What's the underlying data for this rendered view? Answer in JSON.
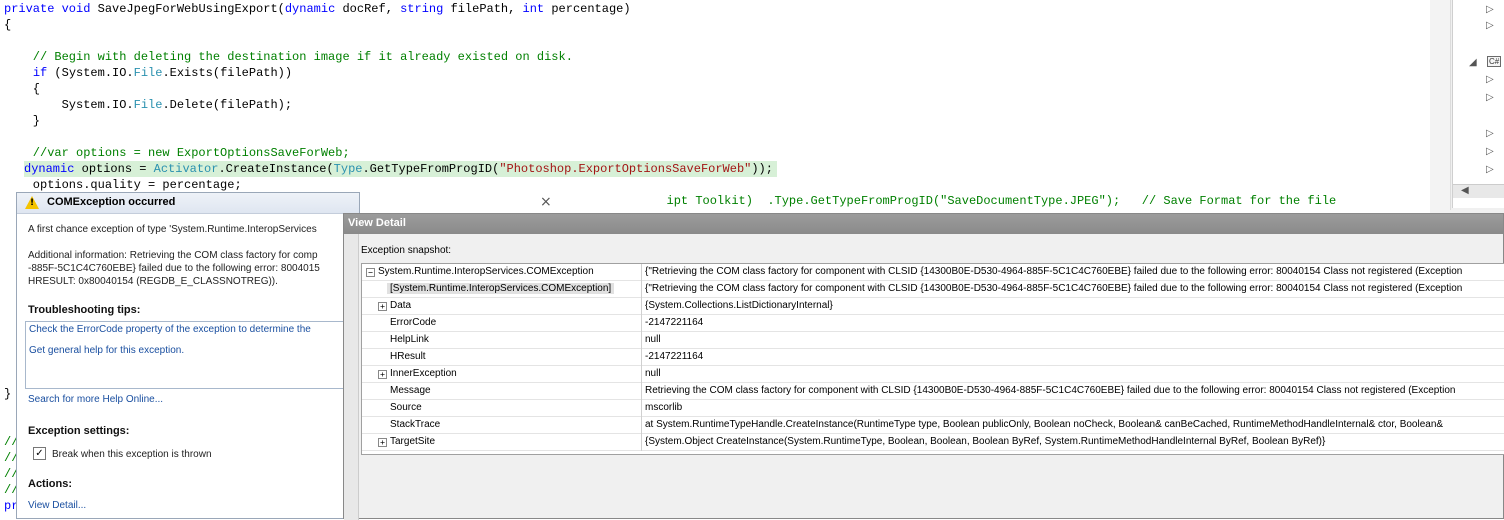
{
  "editor": {
    "lines": [
      {
        "segments": [
          {
            "t": "private void ",
            "c": "kw"
          },
          {
            "t": "SaveJpegForWebUsingExport(",
            "c": ""
          },
          {
            "t": "dynamic",
            "c": "kw"
          },
          {
            "t": " docRef, ",
            "c": ""
          },
          {
            "t": "string",
            "c": "kw"
          },
          {
            "t": " filePath, ",
            "c": ""
          },
          {
            "t": "int",
            "c": "kw"
          },
          {
            "t": " percentage)",
            "c": ""
          }
        ]
      },
      {
        "segments": [
          {
            "t": "{",
            "c": ""
          }
        ]
      },
      {
        "segments": [
          {
            "t": "",
            "c": ""
          }
        ]
      },
      {
        "segments": [
          {
            "t": "    // Begin with deleting the destination image if it already existed on disk.",
            "c": "cm"
          }
        ]
      },
      {
        "segments": [
          {
            "t": "    ",
            "c": ""
          },
          {
            "t": "if",
            "c": "kw"
          },
          {
            "t": " (System.IO.",
            "c": ""
          },
          {
            "t": "File",
            "c": "ty"
          },
          {
            "t": ".Exists(filePath))",
            "c": ""
          }
        ]
      },
      {
        "segments": [
          {
            "t": "    {",
            "c": ""
          }
        ]
      },
      {
        "segments": [
          {
            "t": "        System.IO.",
            "c": ""
          },
          {
            "t": "File",
            "c": "ty"
          },
          {
            "t": ".Delete(filePath);",
            "c": ""
          }
        ]
      },
      {
        "segments": [
          {
            "t": "    }",
            "c": ""
          }
        ]
      },
      {
        "segments": [
          {
            "t": "",
            "c": ""
          }
        ]
      },
      {
        "segments": [
          {
            "t": "    //var options = new ExportOptionsSaveForWeb;",
            "c": "cm"
          }
        ]
      },
      {
        "segments": [
          {
            "t": "    ",
            "c": ""
          },
          {
            "t": "dynamic",
            "c": "kw"
          },
          {
            "t": " options = ",
            "c": ""
          },
          {
            "t": "Activator",
            "c": "ty"
          },
          {
            "t": ".CreateInstance(",
            "c": ""
          },
          {
            "t": "Type",
            "c": "ty"
          },
          {
            "t": ".GetTypeFromProgID(",
            "c": ""
          },
          {
            "t": "\"Photoshop.ExportOptionsSaveForWeb\"",
            "c": "st"
          },
          {
            "t": "));",
            "c": ""
          }
        ]
      },
      {
        "segments": [
          {
            "t": "    options.quality = percentage;",
            "c": ""
          }
        ]
      },
      {
        "segments": [
          {
            "t": "                                                                                            ipt Toolkit)  .Type.GetTypeFromProgID(\"SaveDocumentType.JPEG\");   // Save Format for the file",
            "c": "cm"
          }
        ]
      }
    ],
    "closing_brace": "}",
    "comment_stubs": [
      "//",
      "//",
      "//",
      "//"
    ],
    "last_stub": "pr"
  },
  "popup": {
    "title": "COMException occurred",
    "close_glyph": "×",
    "first_chance": "A first chance exception of type 'System.Runtime.InteropServices",
    "additional_1": "Additional information: Retrieving the COM class factory for comp",
    "additional_2": "-885F-5C1C4C760EBE} failed due to the following error: 8004015",
    "additional_3": "HRESULT: 0x80040154 (REGDB_E_CLASSNOTREG)).",
    "tips_heading": "Troubleshooting tips:",
    "tip_1": "Check the ErrorCode property of the exception to determine the",
    "tip_2": "Get general help for this exception.",
    "search_link": "Search for more Help Online...",
    "settings_heading": "Exception settings:",
    "checkbox_label": "Break when this exception is thrown",
    "checkbox_checked": "✓",
    "actions_heading": "Actions:",
    "view_detail_link": "View Detail..."
  },
  "detail": {
    "title": "View Detail",
    "snapshot_label": "Exception snapshot:",
    "rows": [
      {
        "name": "System.Runtime.InteropServices.COMException",
        "value": "{\"Retrieving the COM class factory for component with CLSID {14300B0E-D530-4964-885F-5C1C4C760EBE} failed due to the following error: 80040154 Class not registered (Exception",
        "exp": "−",
        "indent": 0,
        "sel": false
      },
      {
        "name": "[System.Runtime.InteropServices.COMException]",
        "value": "{\"Retrieving the COM class factory for component with CLSID {14300B0E-D530-4964-885F-5C1C4C760EBE} failed due to the following error: 80040154 Class not registered (Exception",
        "exp": "",
        "indent": 1,
        "sel": true
      },
      {
        "name": "Data",
        "value": "{System.Collections.ListDictionaryInternal}",
        "exp": "+",
        "indent": 1,
        "sel": false
      },
      {
        "name": "ErrorCode",
        "value": "-2147221164",
        "exp": "",
        "indent": 1,
        "sel": false
      },
      {
        "name": "HelpLink",
        "value": "null",
        "exp": "",
        "indent": 1,
        "sel": false
      },
      {
        "name": "HResult",
        "value": "-2147221164",
        "exp": "",
        "indent": 1,
        "sel": false
      },
      {
        "name": "InnerException",
        "value": "null",
        "exp": "+",
        "indent": 1,
        "sel": false
      },
      {
        "name": "Message",
        "value": "Retrieving the COM class factory for component with CLSID {14300B0E-D530-4964-885F-5C1C4C760EBE} failed due to the following error: 80040154 Class not registered (Exception",
        "exp": "",
        "indent": 1,
        "sel": false
      },
      {
        "name": "Source",
        "value": "mscorlib",
        "exp": "",
        "indent": 1,
        "sel": false
      },
      {
        "name": "StackTrace",
        "value": "   at System.RuntimeTypeHandle.CreateInstance(RuntimeType type, Boolean publicOnly, Boolean noCheck, Boolean& canBeCached, RuntimeMethodHandleInternal& ctor, Boolean&",
        "exp": "",
        "indent": 1,
        "sel": false
      },
      {
        "name": "TargetSite",
        "value": "{System.Object CreateInstance(System.RuntimeType, Boolean, Boolean, Boolean ByRef, System.RuntimeMethodHandleInternal ByRef, Boolean ByRef)}",
        "exp": "+",
        "indent": 1,
        "sel": false
      }
    ]
  },
  "right_panel": {
    "arrows": [
      "▷",
      "▷",
      "◢",
      "▷",
      "▷",
      "▷",
      "▷",
      "▷",
      "▷",
      "◀"
    ],
    "cs_badge": "C#"
  }
}
